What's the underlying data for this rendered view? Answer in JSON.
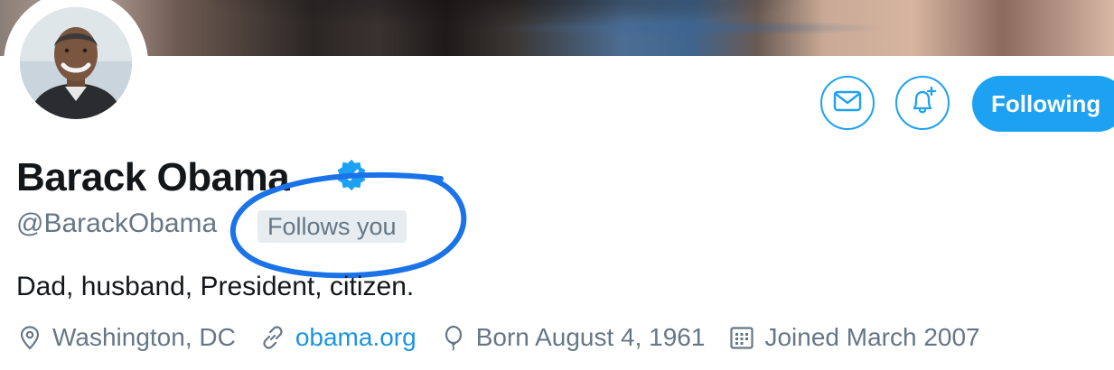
{
  "profile": {
    "name": "Barack Obama",
    "handle": "@BarackObama",
    "follows_you": "Follows you",
    "bio": "Dad, husband, President, citizen.",
    "verified": true
  },
  "actions": {
    "following_label": "Following",
    "message_icon": "envelope-icon",
    "notify_icon": "bell-plus-icon"
  },
  "meta": {
    "location": "Washington, DC",
    "website": "obama.org",
    "birthday": "Born August 4, 1961",
    "joined": "Joined March 2007"
  },
  "colors": {
    "accent": "#1da1f2",
    "link": "#1b95e0",
    "secondary_text": "#657786",
    "annotation": "#1a73e8"
  }
}
